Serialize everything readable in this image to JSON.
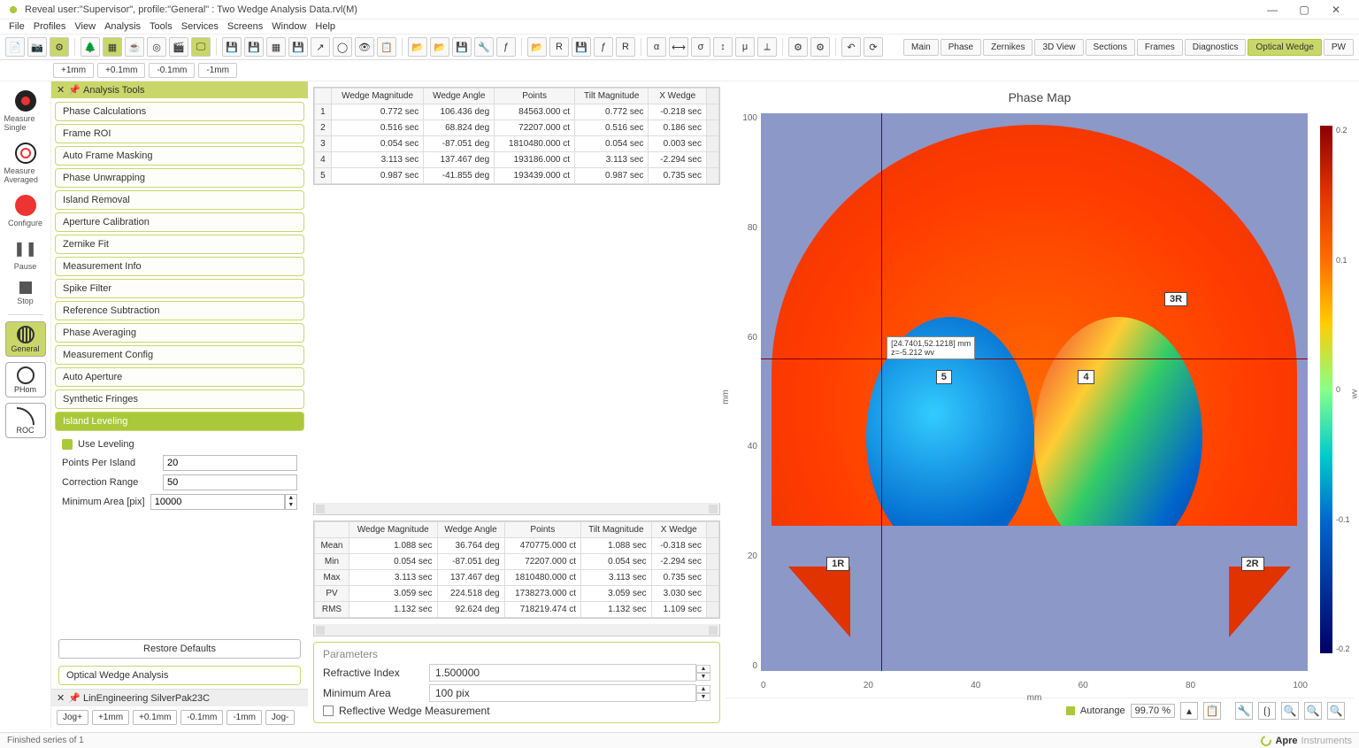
{
  "window": {
    "title": "Reveal user:\"Supervisor\", profile:\"General\" : Two Wedge Analysis Data.rvl(M)",
    "min": "—",
    "max": "▢",
    "close": "✕"
  },
  "menu": [
    "File",
    "Profiles",
    "View",
    "Analysis",
    "Tools",
    "Services",
    "Screens",
    "Window",
    "Help"
  ],
  "jog": [
    "+1mm",
    "+0.1mm",
    "-0.1mm",
    "-1mm"
  ],
  "view_tabs": [
    "Main",
    "Phase",
    "Zernikes",
    "3D View",
    "Sections",
    "Frames",
    "Diagnostics",
    "Optical Wedge",
    "PW"
  ],
  "view_tab_active": 7,
  "left_actions": {
    "measure_single": "Measure Single",
    "measure_averaged": "Measure Averaged",
    "configure": "Configure",
    "pause": "Pause",
    "stop": "Stop",
    "general": "General",
    "phom": "PHom",
    "roc": "ROC"
  },
  "tools_panel": {
    "title": "Analysis Tools",
    "items": [
      "Phase Calculations",
      "Frame ROI",
      "Auto Frame Masking",
      "Phase Unwrapping",
      "Island Removal",
      "Aperture Calibration",
      "Zernike Fit",
      "Measurement Info",
      "Spike Filter",
      "Reference Subtraction",
      "Phase Averaging",
      "Measurement Config",
      "Auto Aperture",
      "Synthetic Fringes",
      "Island Leveling"
    ],
    "active_index": 14,
    "leveling": {
      "use_label": "Use Leveling",
      "ppi_label": "Points Per Island",
      "ppi_value": "20",
      "cr_label": "Correction Range",
      "cr_value": "50",
      "ma_label": "Minimum Area [pix]",
      "ma_value": "10000"
    },
    "restore": "Restore Defaults",
    "optical": "Optical Wedge Analysis"
  },
  "motor": {
    "title": "LinEngineering SilverPak23C",
    "buttons": [
      "Jog+",
      "+1mm",
      "+0.1mm",
      "-0.1mm",
      "-1mm",
      "Jog-"
    ]
  },
  "table_headers": [
    "Wedge Magnitude",
    "Wedge Angle",
    "Points",
    "Tilt Magnitude",
    "X Wedge"
  ],
  "table1_row_labels": [
    "1",
    "2",
    "3",
    "4",
    "5"
  ],
  "table1": [
    [
      "0.772 sec",
      "106.436 deg",
      "84563.000 ct",
      "0.772 sec",
      "-0.218 sec"
    ],
    [
      "0.516 sec",
      "68.824 deg",
      "72207.000 ct",
      "0.516 sec",
      "0.186 sec"
    ],
    [
      "0.054 sec",
      "-87.051 deg",
      "1810480.000 ct",
      "0.054 sec",
      "0.003 sec"
    ],
    [
      "3.113 sec",
      "137.467 deg",
      "193186.000 ct",
      "3.113 sec",
      "-2.294 sec"
    ],
    [
      "0.987 sec",
      "-41.855 deg",
      "193439.000 ct",
      "0.987 sec",
      "0.735 sec"
    ]
  ],
  "table2_row_labels": [
    "Mean",
    "Min",
    "Max",
    "PV",
    "RMS"
  ],
  "table2": [
    [
      "1.088 sec",
      "36.764 deg",
      "470775.000 ct",
      "1.088 sec",
      "-0.318 sec"
    ],
    [
      "0.054 sec",
      "-87.051 deg",
      "72207.000 ct",
      "0.054 sec",
      "-2.294 sec"
    ],
    [
      "3.113 sec",
      "137.467 deg",
      "1810480.000 ct",
      "3.113 sec",
      "0.735 sec"
    ],
    [
      "3.059 sec",
      "224.518 deg",
      "1738273.000 ct",
      "3.059 sec",
      "3.030 sec"
    ],
    [
      "1.132 sec",
      "92.624 deg",
      "718219.474 ct",
      "1.132 sec",
      "1.109 sec"
    ]
  ],
  "params": {
    "title": "Parameters",
    "ri_label": "Refractive Index",
    "ri_value": "1.500000",
    "ma_label": "Minimum Area",
    "ma_value": "100 pix",
    "refl_label": "Reflective Wedge Measurement"
  },
  "chart": {
    "title": "Phase Map",
    "yticks": [
      "100",
      "80",
      "60",
      "40",
      "20",
      "0"
    ],
    "xticks": [
      "0",
      "20",
      "40",
      "60",
      "80",
      "100"
    ],
    "xlabel": "mm",
    "ylabel": "mm",
    "tooltip1": "[24.7401,52.1218] mm",
    "tooltip2": "z=-5.212 wv",
    "labels": {
      "r3": "3R",
      "r4": "4",
      "r5": "5",
      "r1": "1R",
      "r2": "2R"
    },
    "cb_ticks": [
      "0.2",
      "0.1",
      "0",
      "-0.1",
      "-0.2"
    ],
    "cb_unit": "wv",
    "autorange_label": "Autorange",
    "autorange_value": "99.70 %"
  },
  "chart_data": {
    "type": "heatmap",
    "title": "Phase Map",
    "xlabel": "mm",
    "ylabel": "mm",
    "xlim": [
      0,
      110
    ],
    "ylim": [
      0,
      110
    ],
    "colorbar": {
      "unit": "wv",
      "min": -0.25,
      "max": 0.25
    },
    "regions": [
      {
        "id": "3R",
        "shape": "semicircle",
        "cx": 55,
        "cy_base": 40,
        "r": 55,
        "value_approx": 0.12
      },
      {
        "id": "5",
        "shape": "circle",
        "cx": 32,
        "cy": 48,
        "r": 15,
        "gradient": "cyan-to-blue",
        "value_approx": -0.15
      },
      {
        "id": "4",
        "shape": "circle",
        "cx": 62,
        "cy": 48,
        "r": 15,
        "gradient": "rainbow",
        "value_approx": 0.0
      },
      {
        "id": "1R",
        "shape": "triangle",
        "cx": 18,
        "cy": 22,
        "value_approx": 0.18
      },
      {
        "id": "2R",
        "shape": "triangle",
        "cx": 95,
        "cy": 22,
        "value_approx": 0.18
      }
    ],
    "cursor": {
      "x": 24.7401,
      "y": 52.1218,
      "z": -5.212,
      "z_unit": "wv"
    }
  },
  "status": "Finished series of 1",
  "brand": {
    "name": "Apre",
    "sub": "Instruments"
  }
}
